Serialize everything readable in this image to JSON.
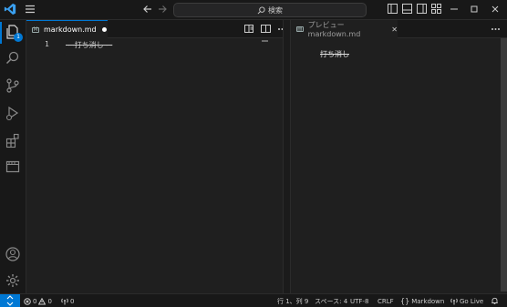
{
  "titlebar": {
    "search_label": "検索"
  },
  "activity_bar": {
    "explorer_badge": "1"
  },
  "editor_left": {
    "tab_label": "markdown.md",
    "line_number": "1",
    "line_text": "~~打ち消し~~"
  },
  "editor_right": {
    "tab_label": "プレビュー markdown.md",
    "preview_text": "打ち消し"
  },
  "statusbar": {
    "errors": "0",
    "warnings": "0",
    "ports": "0",
    "cursor_position": "行 1、列 9",
    "indent": "スペース: 4",
    "encoding": "UTF-8",
    "line_ending": "CRLF",
    "language": "Markdown",
    "go_live": "Go Live"
  },
  "colors": {
    "accent": "#0078d4",
    "background": "#1f1f1f",
    "chrome": "#181818"
  }
}
